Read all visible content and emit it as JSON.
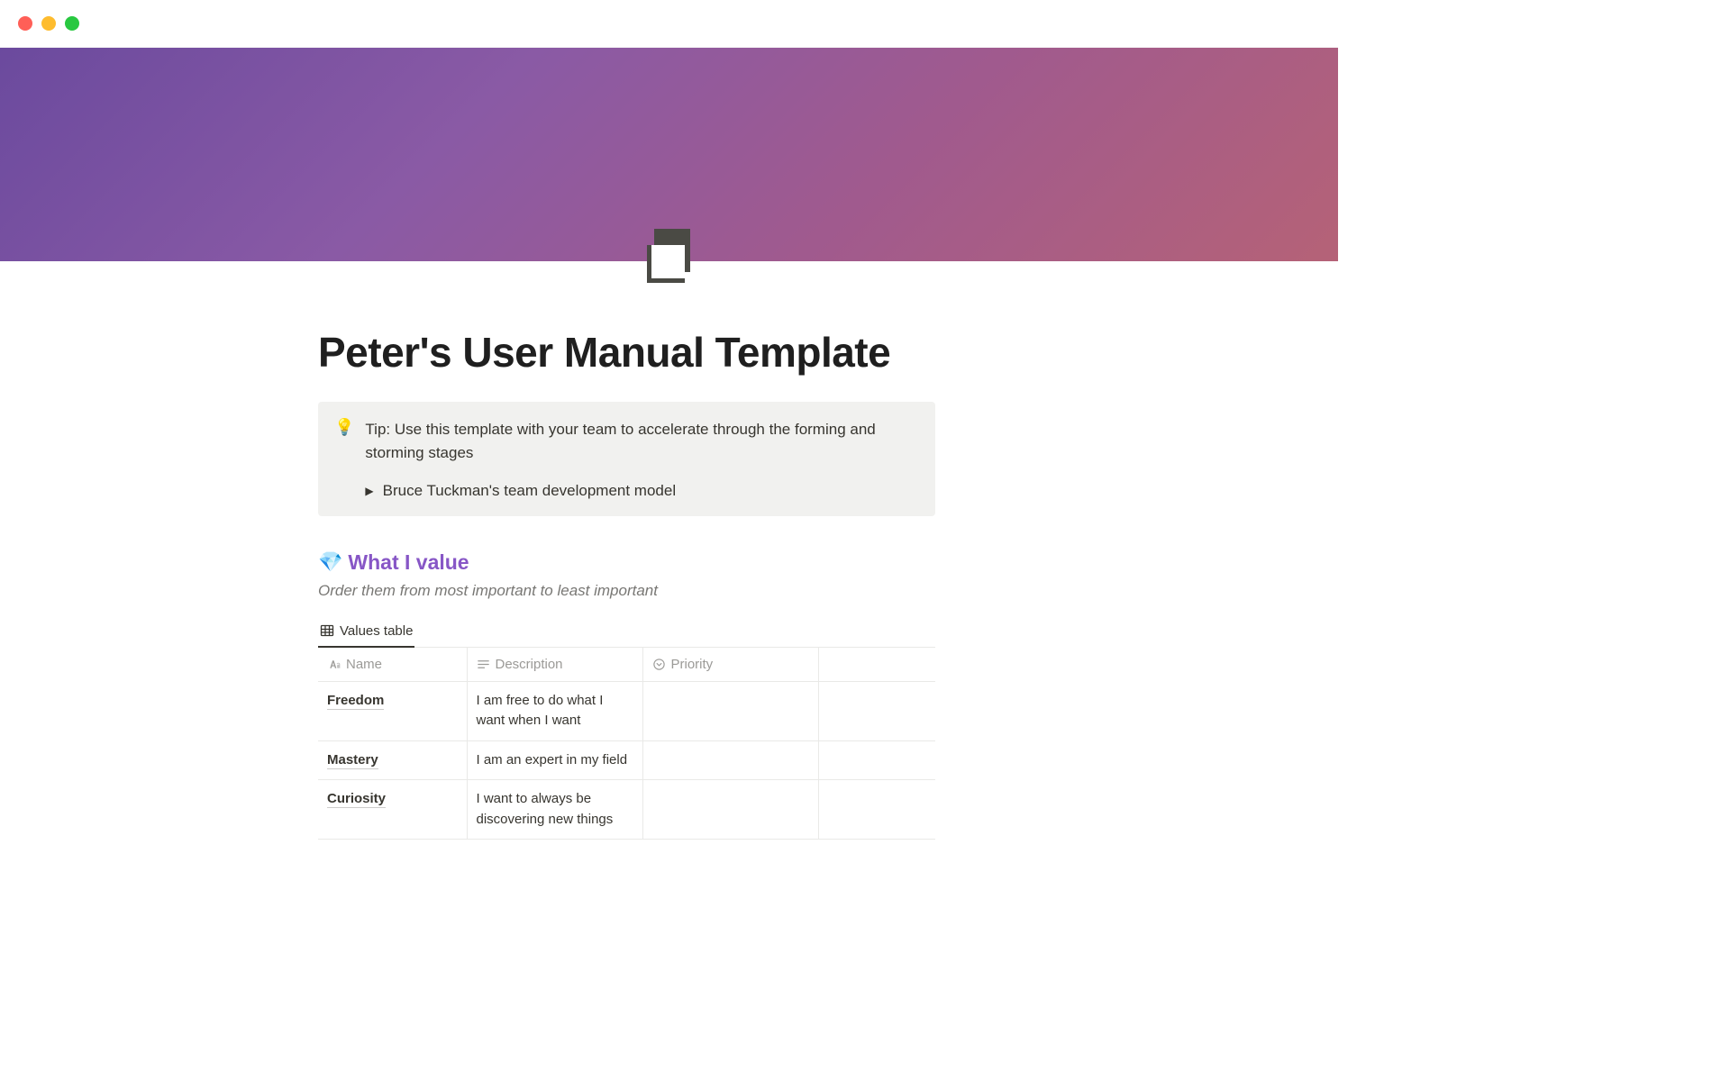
{
  "page": {
    "title": "Peter's User Manual Template"
  },
  "callout": {
    "icon": "💡",
    "text": "Tip: Use this template with your team to accelerate through the forming and storming stages",
    "toggle_label": "Bruce Tuckman's team development model"
  },
  "section_values": {
    "icon": "💎",
    "heading": "What I value",
    "subtitle": "Order them from most important to least important"
  },
  "db": {
    "view_label": "Values table",
    "columns": {
      "name": "Name",
      "description": "Description",
      "priority": "Priority"
    },
    "rows": [
      {
        "name": "Freedom",
        "description": "I am free to do what I want when I want",
        "priority": ""
      },
      {
        "name": "Mastery",
        "description": "I am an expert in my field",
        "priority": ""
      },
      {
        "name": "Curiosity",
        "description": "I want to always be discovering new things",
        "priority": ""
      }
    ]
  }
}
